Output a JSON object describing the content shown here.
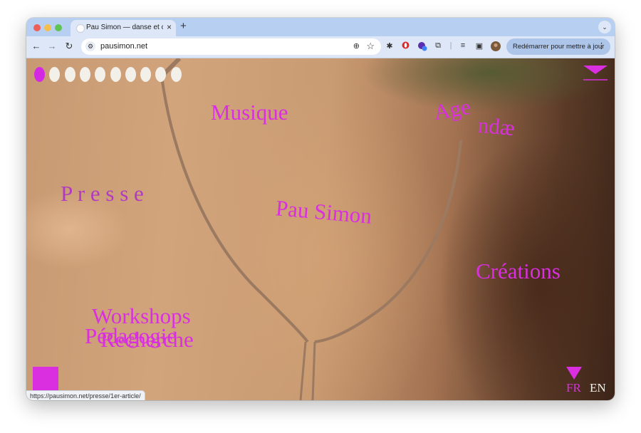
{
  "browser": {
    "tab_title": "Pau Simon — danse et chorégraphie",
    "tab_close": "×",
    "new_tab": "+",
    "tab_menu": "⌄",
    "back": "←",
    "forward": "→",
    "reload": "↻",
    "site_settings_icon": "⚙",
    "url": "pausimon.net",
    "zoom_icon": "⊕",
    "bookmark_icon": "☆",
    "update_label": "Redémarrer pour mettre à jour",
    "update_menu": "⋮",
    "traffic_lights": [
      "#ee5f58",
      "#f5bf4f",
      "#5fc453"
    ],
    "status_url": "https://pausimon.net/presse/1er-article/"
  },
  "page": {
    "accent": "#d92fe0",
    "slides_total": 10,
    "slide_active": 1,
    "nav": {
      "musique": "Musique",
      "agenda_1": "Age",
      "agenda_2": "ndæ",
      "presse": "P r e s s e",
      "home": "Pau Simon",
      "creations": "Créations",
      "workshops": "Workshops",
      "pedagogie": "Pédagogie",
      "recherche": "Recherche"
    },
    "lang": {
      "fr": "FR",
      "en": "EN",
      "active": "FR"
    }
  }
}
